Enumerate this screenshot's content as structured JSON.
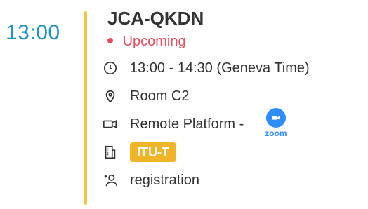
{
  "event": {
    "start_time_display": "13:00",
    "title": "JCA-QKDN",
    "status": "Upcoming",
    "time_range": "13:00 - 14:30 (Geneva Time)",
    "location": "Room C2",
    "remote_platform_label": "Remote Platform -",
    "zoom_label": "zoom",
    "organization_badge": "ITU-T",
    "registration_label": "registration"
  },
  "colors": {
    "time_blue": "#1f93c9",
    "timeline_yellow": "#f3c63c",
    "status_red": "#e84a5f",
    "badge_orange": "#f0b429",
    "zoom_blue": "#2d8cff"
  },
  "icons": {
    "time": "clock-icon",
    "location": "location-pin-icon",
    "remote": "video-camera-icon",
    "zoom": "zoom-logo-icon",
    "organization": "building-icon",
    "registration": "add-user-icon"
  }
}
